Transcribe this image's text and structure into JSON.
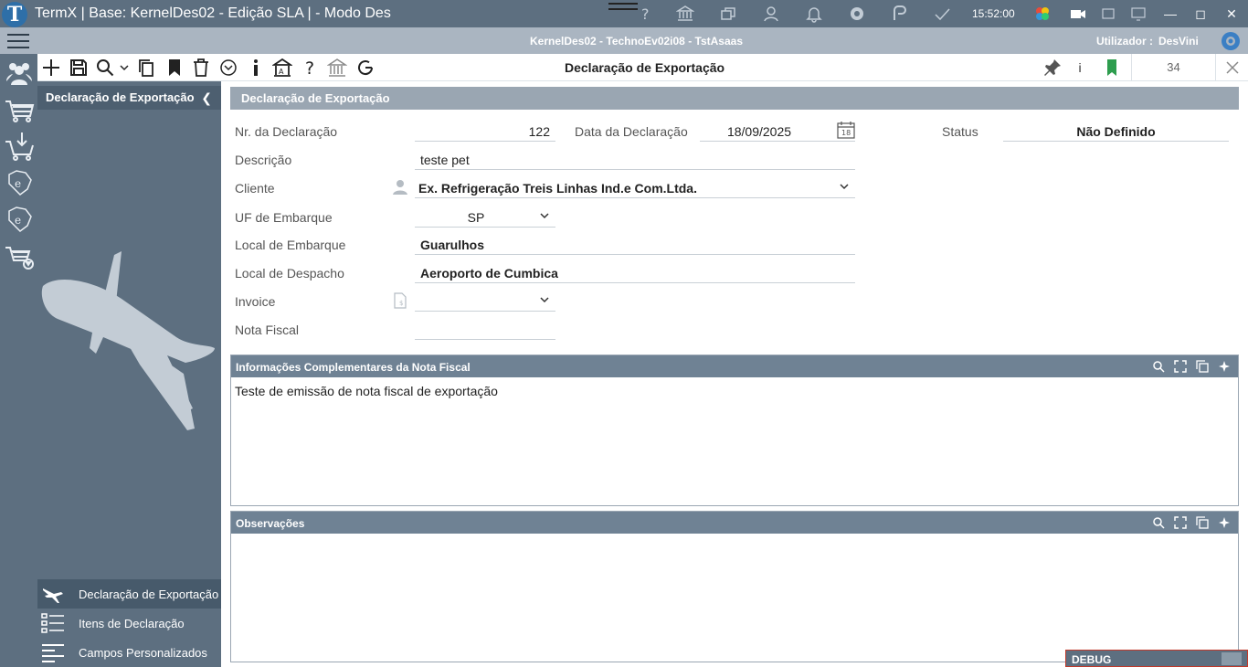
{
  "window": {
    "title": "TermX | Base: KernelDes02 - Edição SLA | - Modo Des",
    "time": "15:52:00"
  },
  "envbar": {
    "environment": "KernelDes02 - TechnoEv02i08 - TstAsaas",
    "user_label": "Utilizador :",
    "user_name": "DesVini"
  },
  "toolbar": {
    "page_title": "Declaração de Exportação",
    "info_label": "i",
    "record_count": "34"
  },
  "left_panel": {
    "title": "Declaração de Exportação",
    "nav": [
      {
        "label": "Declaração de Exportação"
      },
      {
        "label": "Itens de Declaração"
      },
      {
        "label": "Campos Personalizados"
      }
    ]
  },
  "form": {
    "section_title": "Declaração de Exportação",
    "nr_label": "Nr. da Declaração",
    "nr_value": "122",
    "data_label": "Data da Declaração",
    "data_value": "18/09/2025",
    "calendar_day": "18",
    "status_label": "Status",
    "status_value": "Não Definido",
    "descricao_label": "Descrição",
    "descricao_value": "teste pet",
    "cliente_label": "Cliente",
    "cliente_value": "Ex. Refrigeração Treis Linhas Ind.e Com.Ltda.",
    "uf_label": "UF de Embarque",
    "uf_value": "SP",
    "local_embarque_label": "Local de Embarque",
    "local_embarque_value": "Guarulhos",
    "local_despacho_label": "Local de Despacho",
    "local_despacho_value": "Aeroporto de Cumbica",
    "invoice_label": "Invoice",
    "invoice_value": "",
    "nota_label": "Nota Fiscal",
    "nota_value": ""
  },
  "info_panel": {
    "title": "Informações Complementares da Nota Fiscal",
    "text": "Teste de emissão de nota fiscal de exportação"
  },
  "obs_panel": {
    "title": "Observações",
    "text": ""
  },
  "debug": {
    "label": "DEBUG"
  }
}
